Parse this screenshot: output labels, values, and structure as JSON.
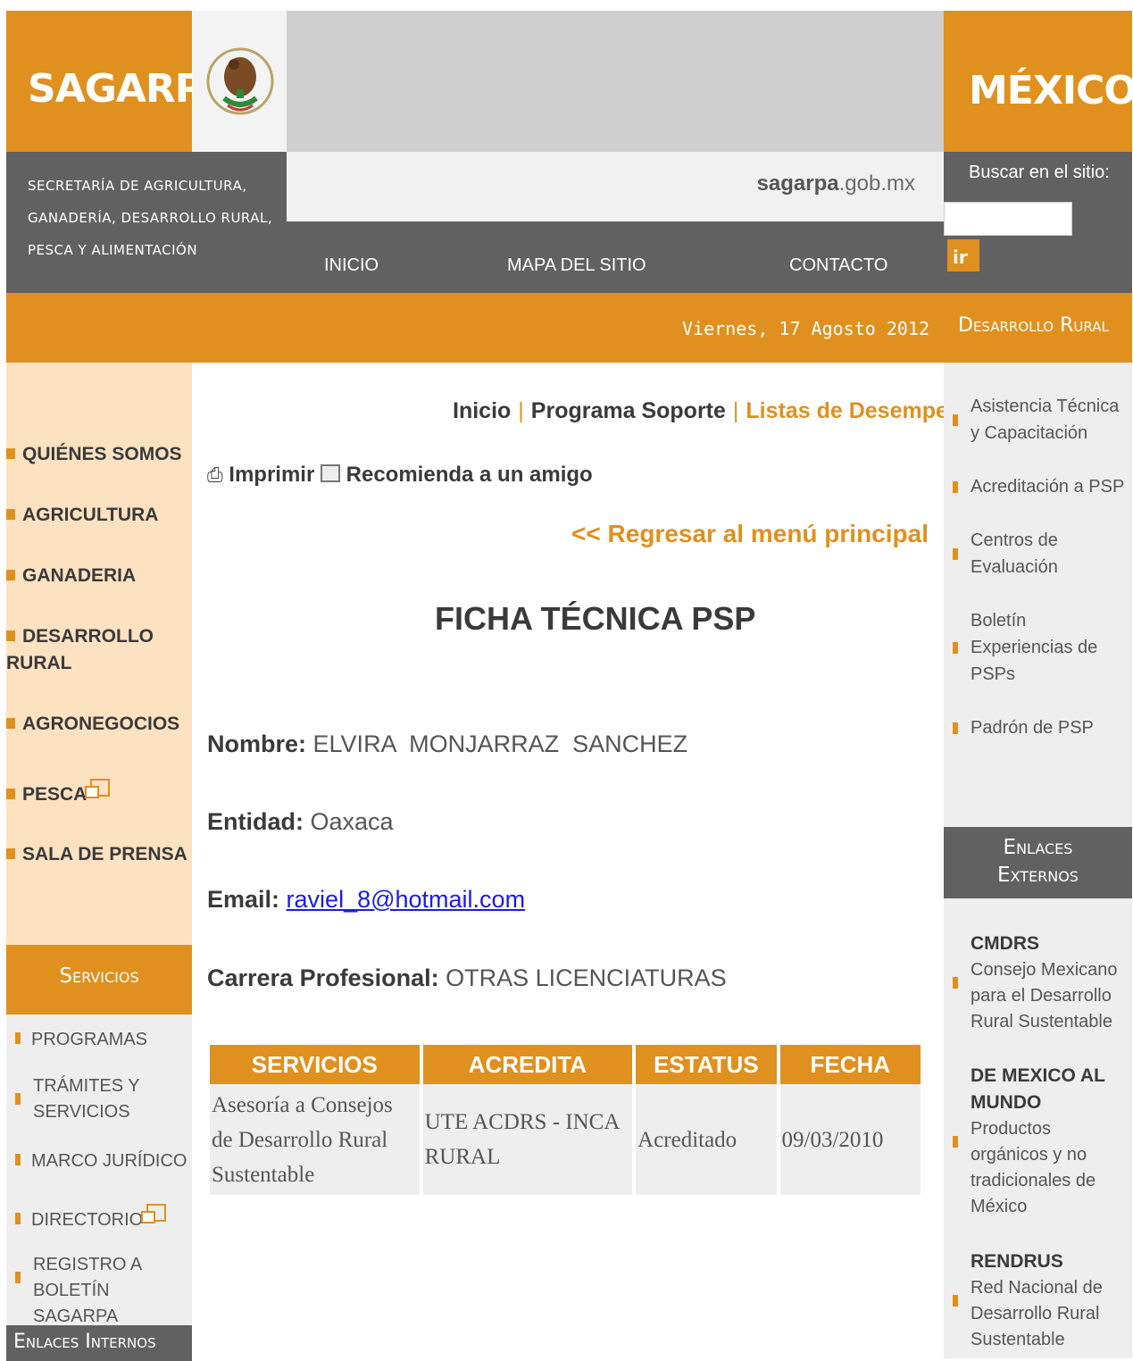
{
  "header": {
    "logo_left": "SAGARPA",
    "logo_right": "MÉXICO",
    "secretaria_lines": [
      "SECRETARÍA DE AGRICULTURA,",
      "GANADERÍA, DESARROLLO RURAL,",
      "PESCA Y ALIMENTACIÓN"
    ],
    "domain_bold": "sagarpa",
    "domain_rest": ".gob.mx",
    "nav": [
      "INICIO",
      "MAPA DEL SITIO",
      "CONTACTO"
    ],
    "search_label": "Buscar en el sitio:",
    "search_value": "",
    "search_button": "ir",
    "date": "Viernes, 17 Agosto 2012",
    "section": "Desarrollo Rural"
  },
  "left_nav": [
    {
      "label": "QUIÉNES SOMOS"
    },
    {
      "label": "AGRICULTURA"
    },
    {
      "label": "GANADERIA"
    },
    {
      "label": "DESARROLLO RURAL"
    },
    {
      "label": "AGRONEGOCIOS"
    },
    {
      "label": "PESCA"
    },
    {
      "label": "SALA DE PRENSA"
    }
  ],
  "servicios": {
    "title": "Servicios",
    "items": [
      "PROGRAMAS",
      "TRÁMITES Y SERVICIOS",
      "MARCO JURÍDICO",
      "DIRECTORIO",
      "REGISTRO A BOLETÍN SAGARPA"
    ]
  },
  "enlaces_internos": "Enlaces Internos",
  "breadcrumb": [
    "Inicio",
    "Programa Soporte",
    "Listas de Desempeño"
  ],
  "tools": {
    "print": "Imprimir",
    "recommend": "Recomienda a un amigo"
  },
  "back_link": "<< Regresar al menú principal",
  "title": "FICHA TÉCNICA PSP",
  "fields": {
    "nombre_label": "Nombre:",
    "nombre": "ELVIRA  MONJARRAZ  SANCHEZ",
    "entidad_label": "Entidad:",
    "entidad": "Oaxaca",
    "email_label": "Email:",
    "email": "raviel_8@hotmail.com",
    "carrera_label": "Carrera Profesional:",
    "carrera": "OTRAS LICENCIATURAS"
  },
  "table": {
    "headers": [
      "SERVICIOS",
      "ACREDITA",
      "ESTATUS",
      "FECHA"
    ],
    "rows": [
      [
        "Asesoría a Consejos de Desarrollo Rural Sustentable",
        "UTE ACDRS - INCA RURAL",
        "Acreditado",
        "09/03/2010"
      ]
    ]
  },
  "right_nav": [
    "Asistencia Técnica y Capacitación",
    "Acreditación a PSP",
    "Centros de Evaluación",
    "Boletín Experiencias de PSPs",
    "Padrón de PSP"
  ],
  "enlaces_externos": [
    "Enlaces",
    "Externos"
  ],
  "external_links": [
    {
      "title": "CMDRS",
      "desc": "Consejo Mexicano para el Desarrollo Rural Sustentable"
    },
    {
      "title": "DE MEXICO AL MUNDO",
      "desc": "Productos orgánicos y no tradicionales de México"
    },
    {
      "title": "RENDRUS",
      "desc": "Red Nacional de Desarrollo Rural Sustentable"
    }
  ],
  "colors": {
    "accent": "#e0901e",
    "dark_gray": "#616161",
    "light_peach": "#fde2c2",
    "link_blue": "#1a1aee"
  }
}
